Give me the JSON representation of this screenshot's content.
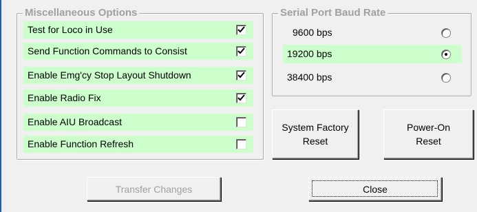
{
  "misc_options": {
    "title": "Miscellaneous Options",
    "row_color": "#ccffcc",
    "items": [
      {
        "label": "Test for Loco in Use",
        "checked": true
      },
      {
        "label": "Send Function Commands to Consist",
        "checked": true
      },
      {
        "label": "Enable Emg'cy Stop Layout Shutdown",
        "checked": true
      },
      {
        "label": "Enable Radio Fix",
        "checked": true
      },
      {
        "label": "Enable AIU Broadcast",
        "checked": false
      },
      {
        "label": "Enable Function Refresh",
        "checked": false
      }
    ]
  },
  "baud_rate": {
    "title": "Serial Port Baud Rate",
    "selected_row_color": "#ccffcc",
    "options": [
      {
        "label": "9600 bps",
        "selected": false
      },
      {
        "label": "19200 bps",
        "selected": true
      },
      {
        "label": "38400 bps",
        "selected": false
      }
    ]
  },
  "buttons": {
    "factory_reset": "System Factory\nReset",
    "power_on_reset": "Power-On\nReset",
    "transfer_changes": "Transfer Changes",
    "close": "Close"
  }
}
